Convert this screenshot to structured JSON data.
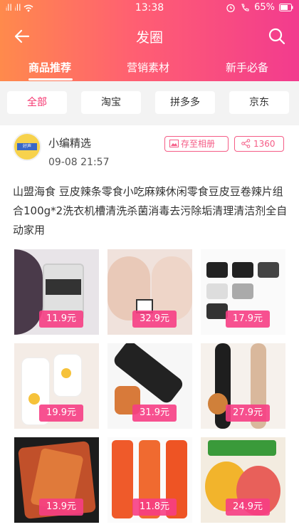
{
  "status_bar": {
    "signal_left": "ᵢll ᵢll",
    "time": "13:38",
    "battery": "65%",
    "icons": [
      "signal-icon",
      "wifi-icon",
      "alarm-icon",
      "call-icon",
      "battery-icon"
    ]
  },
  "nav": {
    "title": "发圈",
    "back_icon": "back-arrow-icon",
    "search_icon": "search-icon"
  },
  "tabs": [
    {
      "label": "商品推荐",
      "active": true
    },
    {
      "label": "营销素材",
      "active": false
    },
    {
      "label": "新手必备",
      "active": false
    }
  ],
  "filters": [
    {
      "label": "全部",
      "active": true
    },
    {
      "label": "淘宝",
      "active": false
    },
    {
      "label": "拼多多",
      "active": false
    },
    {
      "label": "京东",
      "active": false
    }
  ],
  "post": {
    "avatar_text": "好声",
    "author": "小编精选",
    "time": "09-08 21:57",
    "save_label": "存至相册",
    "share_count": "1360",
    "text": "山盟海食 豆皮辣条零食小吃麻辣休闲零食豆皮豆卷辣片组合100g*2洗衣机槽清洗杀菌消毒去污除垢清理清洁剂全自动家用",
    "products": [
      {
        "price": "11.9元"
      },
      {
        "price": "32.9元"
      },
      {
        "price": "17.9元"
      },
      {
        "price": "19.9元"
      },
      {
        "price": "31.9元"
      },
      {
        "price": "27.9元"
      },
      {
        "price": "13.9元"
      },
      {
        "price": "11.8元"
      },
      {
        "price": "24.9元"
      }
    ]
  },
  "colors": {
    "header_start": "#ff8a4c",
    "header_end": "#f23b8e",
    "accent": "#f5356f"
  }
}
